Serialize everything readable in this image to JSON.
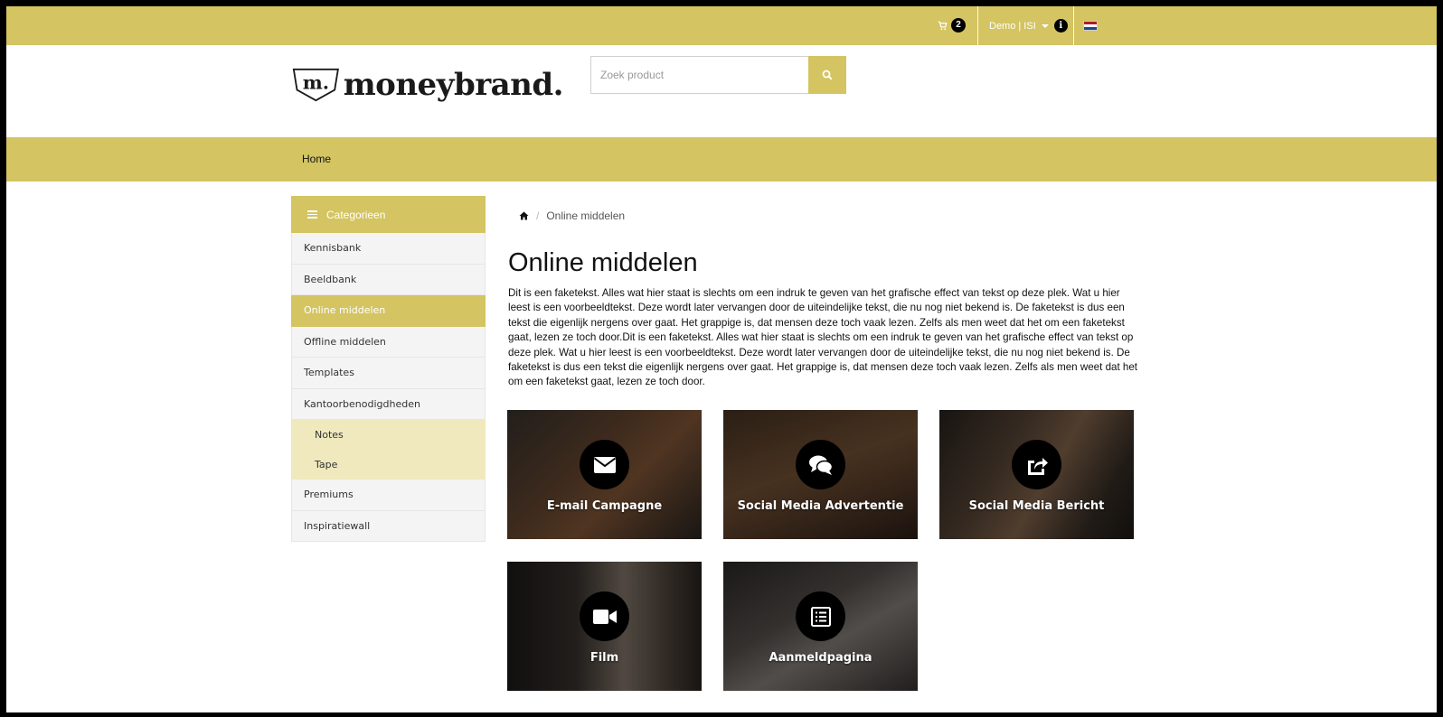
{
  "topbar": {
    "cart_count": "2",
    "user_label": "Demo | ISI"
  },
  "logo": {
    "mark": "m.",
    "word": "moneybrand."
  },
  "search": {
    "placeholder": "Zoek product"
  },
  "nav": {
    "home_label": "Home"
  },
  "sidebar": {
    "header": "Categorieen",
    "items": [
      {
        "label": "Kennisbank"
      },
      {
        "label": "Beeldbank"
      },
      {
        "label": "Online middelen",
        "active": true
      },
      {
        "label": "Offline middelen"
      },
      {
        "label": "Templates"
      },
      {
        "label": "Kantoorbenodigdheden"
      }
    ],
    "subitems": [
      {
        "label": "Notes"
      },
      {
        "label": "Tape"
      }
    ],
    "items_after": [
      {
        "label": "Premiums"
      },
      {
        "label": "Inspiratiewall"
      }
    ]
  },
  "breadcrumb": {
    "current": "Online middelen"
  },
  "main": {
    "title": "Online middelen",
    "description": "Dit is een faketekst. Alles wat hier staat is slechts om een indruk te geven van het grafische effect van tekst op deze plek. Wat u hier leest is een voorbeeldtekst. Deze wordt later vervangen door de uiteindelijke tekst, die nu nog niet bekend is. De faketekst is dus een tekst die eigenlijk nergens over gaat. Het grappige is, dat mensen deze toch vaak lezen. Zelfs als men weet dat het om een faketekst gaat, lezen ze toch door.Dit is een faketekst. Alles wat hier staat is slechts om een indruk te geven van het grafische effect van tekst op deze plek. Wat u hier leest is een voorbeeldtekst. Deze wordt later vervangen door de uiteindelijke tekst, die nu nog niet bekend is. De faketekst is dus een tekst die eigenlijk nergens over gaat. Het grappige is, dat mensen deze toch vaak lezen. Zelfs als men weet dat het om een faketekst gaat, lezen ze toch door.",
    "tiles": [
      {
        "label": "E-mail Campagne",
        "icon": "envelope-icon"
      },
      {
        "label": "Social Media Advertentie",
        "icon": "chat-bubbles-icon"
      },
      {
        "label": "Social Media Bericht",
        "icon": "share-icon"
      },
      {
        "label": "Film",
        "icon": "video-camera-icon"
      },
      {
        "label": "Aanmeldpagina",
        "icon": "form-icon"
      }
    ]
  },
  "colors": {
    "brand": "#d4c462",
    "sub_highlight": "#efe9bd",
    "sidebar_item_bg": "#f4f4f4"
  }
}
